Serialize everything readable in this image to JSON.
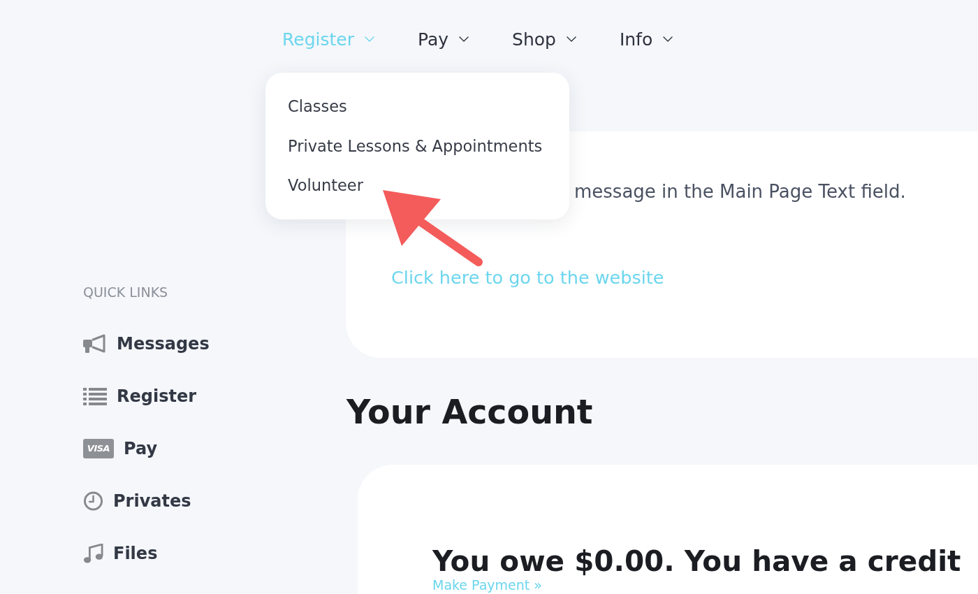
{
  "nav": [
    {
      "label": "Register",
      "selected": true,
      "menu": [
        "Classes",
        "Private Lessons & Appointments",
        "Volunteer"
      ]
    },
    {
      "label": "Pay",
      "selected": false
    },
    {
      "label": "Shop",
      "selected": false
    },
    {
      "label": "Info",
      "selected": false
    }
  ],
  "sidebar": {
    "heading": "QUICK LINKS",
    "items": [
      {
        "label": "Messages"
      },
      {
        "label": "Register"
      },
      {
        "label": "Pay",
        "logo_text": "VISA"
      },
      {
        "label": "Privates"
      },
      {
        "label": "Files"
      }
    ]
  },
  "welcome_card": {
    "message": "message in the Main Page Text field.",
    "link": "Click here to go to the website"
  },
  "account": {
    "heading": "Your Account",
    "balance": "You owe $0.00. You have a credit",
    "payment_link": "Make Payment »"
  }
}
